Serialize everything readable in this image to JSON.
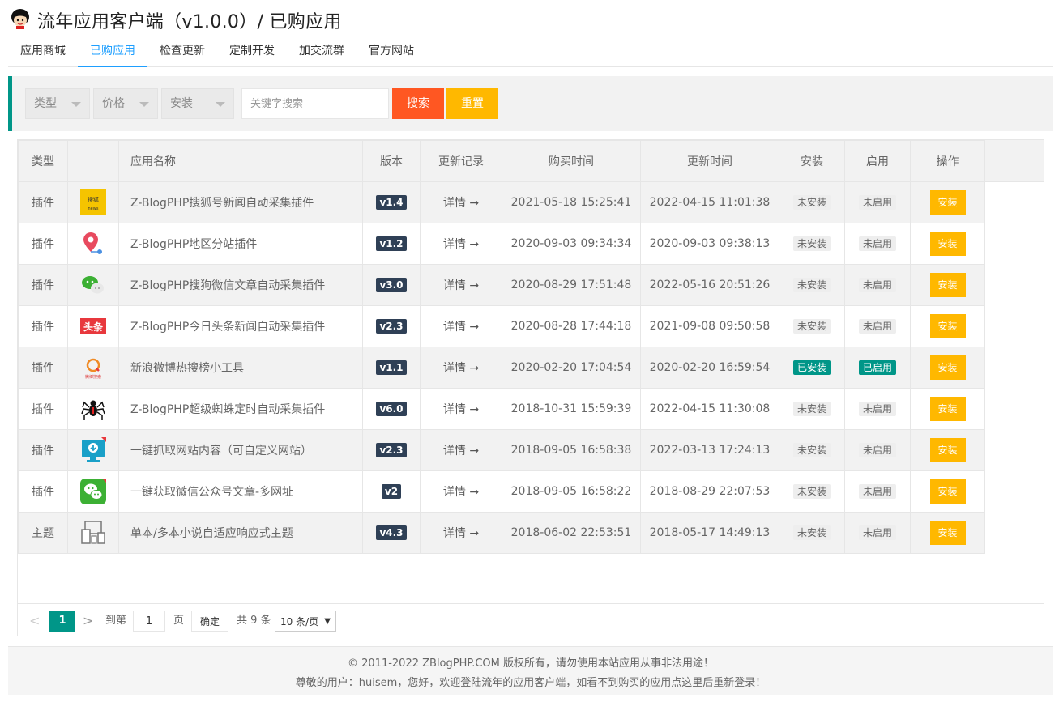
{
  "header": {
    "title": "流年应用客户端（v1.0.0）/ 已购应用"
  },
  "nav": {
    "tabs": [
      {
        "label": "应用商城",
        "active": false
      },
      {
        "label": "已购应用",
        "active": true
      },
      {
        "label": "检查更新",
        "active": false
      },
      {
        "label": "定制开发",
        "active": false
      },
      {
        "label": "加交流群",
        "active": false
      },
      {
        "label": "官方网站",
        "active": false
      }
    ]
  },
  "filters": {
    "type_label": "类型",
    "price_label": "价格",
    "install_label": "安装",
    "keyword_placeholder": "关键字搜索",
    "search_label": "搜索",
    "reset_label": "重置"
  },
  "table": {
    "headers": {
      "type": "类型",
      "name": "应用名称",
      "version": "版本",
      "changelog": "更新记录",
      "purchase_time": "购买时间",
      "update_time": "更新时间",
      "install": "安装",
      "enable": "启用",
      "action": "操作"
    },
    "rows": [
      {
        "type": "插件",
        "icon": "sohu-news-icon",
        "name": "Z-BlogPHP搜狐号新闻自动采集插件",
        "version": "v1.4",
        "changelog": "详情 →",
        "purchase_time": "2021-05-18 15:25:41",
        "update_time": "2022-04-15 11:01:38",
        "install_status": "未安装",
        "enable_status": "未启用",
        "installed": false,
        "action": "安装"
      },
      {
        "type": "插件",
        "icon": "location-pin-icon",
        "name": "Z-BlogPHP地区分站插件",
        "version": "v1.2",
        "changelog": "详情 →",
        "purchase_time": "2020-09-03 09:34:34",
        "update_time": "2020-09-03 09:38:13",
        "install_status": "未安装",
        "enable_status": "未启用",
        "installed": false,
        "action": "安装"
      },
      {
        "type": "插件",
        "icon": "wechat-icon",
        "name": "Z-BlogPHP搜狗微信文章自动采集插件",
        "version": "v3.0",
        "changelog": "详情 →",
        "purchase_time": "2020-08-29 17:51:48",
        "update_time": "2022-05-16 20:51:26",
        "install_status": "未安装",
        "enable_status": "未启用",
        "installed": false,
        "action": "安装"
      },
      {
        "type": "插件",
        "icon": "toutiao-icon",
        "name": "Z-BlogPHP今日头条新闻自动采集插件",
        "version": "v2.3",
        "changelog": "详情 →",
        "purchase_time": "2020-08-28 17:44:18",
        "update_time": "2021-09-08 09:50:58",
        "install_status": "未安装",
        "enable_status": "未启用",
        "installed": false,
        "action": "安装"
      },
      {
        "type": "插件",
        "icon": "weibo-hot-search-icon",
        "name": "新浪微博热搜榜小工具",
        "version": "v1.1",
        "changelog": "详情 →",
        "purchase_time": "2020-02-20 17:04:54",
        "update_time": "2020-02-20 16:59:54",
        "install_status": "已安装",
        "enable_status": "已启用",
        "installed": true,
        "action": "安装"
      },
      {
        "type": "插件",
        "icon": "spider-icon",
        "name": "Z-BlogPHP超级蜘蛛定时自动采集插件",
        "version": "v6.0",
        "changelog": "详情 →",
        "purchase_time": "2018-10-31 15:59:39",
        "update_time": "2022-04-15 11:30:08",
        "install_status": "未安装",
        "enable_status": "未启用",
        "installed": false,
        "action": "安装"
      },
      {
        "type": "插件",
        "icon": "monitor-download-icon",
        "name": "一键抓取网站内容（可自定义网站）",
        "version": "v2.3",
        "changelog": "详情 →",
        "purchase_time": "2018-09-05 16:58:38",
        "update_time": "2022-03-13 17:24:13",
        "install_status": "未安装",
        "enable_status": "未启用",
        "installed": false,
        "action": "安装"
      },
      {
        "type": "插件",
        "icon": "wechat-green-icon",
        "name": "一键获取微信公众号文章-多网址",
        "version": "v2",
        "changelog": "详情 →",
        "purchase_time": "2018-09-05 16:58:22",
        "update_time": "2018-08-29 22:07:53",
        "install_status": "未安装",
        "enable_status": "未启用",
        "installed": false,
        "action": "安装"
      },
      {
        "type": "主题",
        "icon": "responsive-devices-icon",
        "name": "单本/多本小说自适应响应式主题",
        "version": "v4.3",
        "changelog": "详情 →",
        "purchase_time": "2018-06-02 22:53:51",
        "update_time": "2018-05-17 14:49:13",
        "install_status": "未安装",
        "enable_status": "未启用",
        "installed": false,
        "action": "安装"
      }
    ]
  },
  "pagination": {
    "prev": "<",
    "current_page": "1",
    "next": ">",
    "goto_label": "到第",
    "page_input": "1",
    "page_unit": "页",
    "confirm_label": "确定",
    "total_label": "共 9 条",
    "page_size": "10 条/页"
  },
  "footer": {
    "copyright": "© 2011-2022 ZBlogPHP.COM 版权所有，请勿使用本站应用从事非法用途！",
    "greeting": "尊敬的用户：huisem，您好，欢迎登陆流年的应用客户端，如看不到购买的应用点这里后重新登录！"
  },
  "colors": {
    "accent": "#1e9fff",
    "primary_green": "#009688",
    "search": "#ff5722",
    "warn": "#ffb800",
    "version_badge": "#2f4056"
  }
}
